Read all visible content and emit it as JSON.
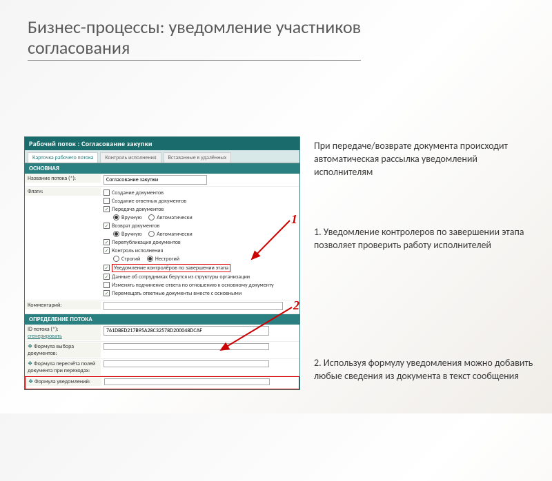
{
  "slide": {
    "title_line1": "Бизнес-процессы: уведомление участников",
    "title_line2": "согласования"
  },
  "app": {
    "window_title": "Рабочий поток : Согласование закупки",
    "tabs": {
      "t1": "Карточка рабочего потока",
      "t2": "Контроль исполнения",
      "t3": "Вставанные в удалённых"
    },
    "section1": "ОСНОВНАЯ",
    "section2": "ОПРЕДЕЛЕНИЕ ПОТОКА",
    "fields": {
      "name_label": "Название потока (*):",
      "name_value": "Согласование закупки",
      "flags_label": "Флаги:",
      "comment_label": "Комментарий:",
      "id_label": "ID потока (*):",
      "id_action": "сгенерировать",
      "id_value": "761DBED217B95A28C32578D200048DCAF",
      "formula_select": "Формула выбора документов:",
      "formula_recalc": "Формула пересчёта полей документа при переходах:",
      "formula_notify": "Формула уведомлений:"
    },
    "flags": {
      "f1": "Создание документов",
      "f2": "Создание ответных документов",
      "f3": "Передача документов",
      "f3r1": "Вручную",
      "f3r2": "Автоматически",
      "f4": "Возврат документов",
      "f4r1": "Вручную",
      "f4r2": "Автоматически",
      "f5": "Перепубликация документов",
      "f6": "Контроль исполнения",
      "f6r1": "Строгий",
      "f6r2": "Нестрогий",
      "f7": "Уведомление контролёров по завершении этапа",
      "f8": "Данные об сотрудниках берутся из структуры организации",
      "f9": "Изменять подчинение ответа по отношению к основному документу",
      "f10": "Перемещать ответные документы вместе с основными"
    }
  },
  "descriptions": {
    "intro": "При передаче/возврате документа происходит автоматическая рассылка уведомлений исполнителям",
    "point1": "1. Уведомление контролеров по завершении этапа позволяет проверить работу исполнителей",
    "point2": "2. Используя формулу уведомления можно добавить любые сведения из документа в текст сообщения"
  },
  "annotations": {
    "n1": "1",
    "n2": "2"
  }
}
